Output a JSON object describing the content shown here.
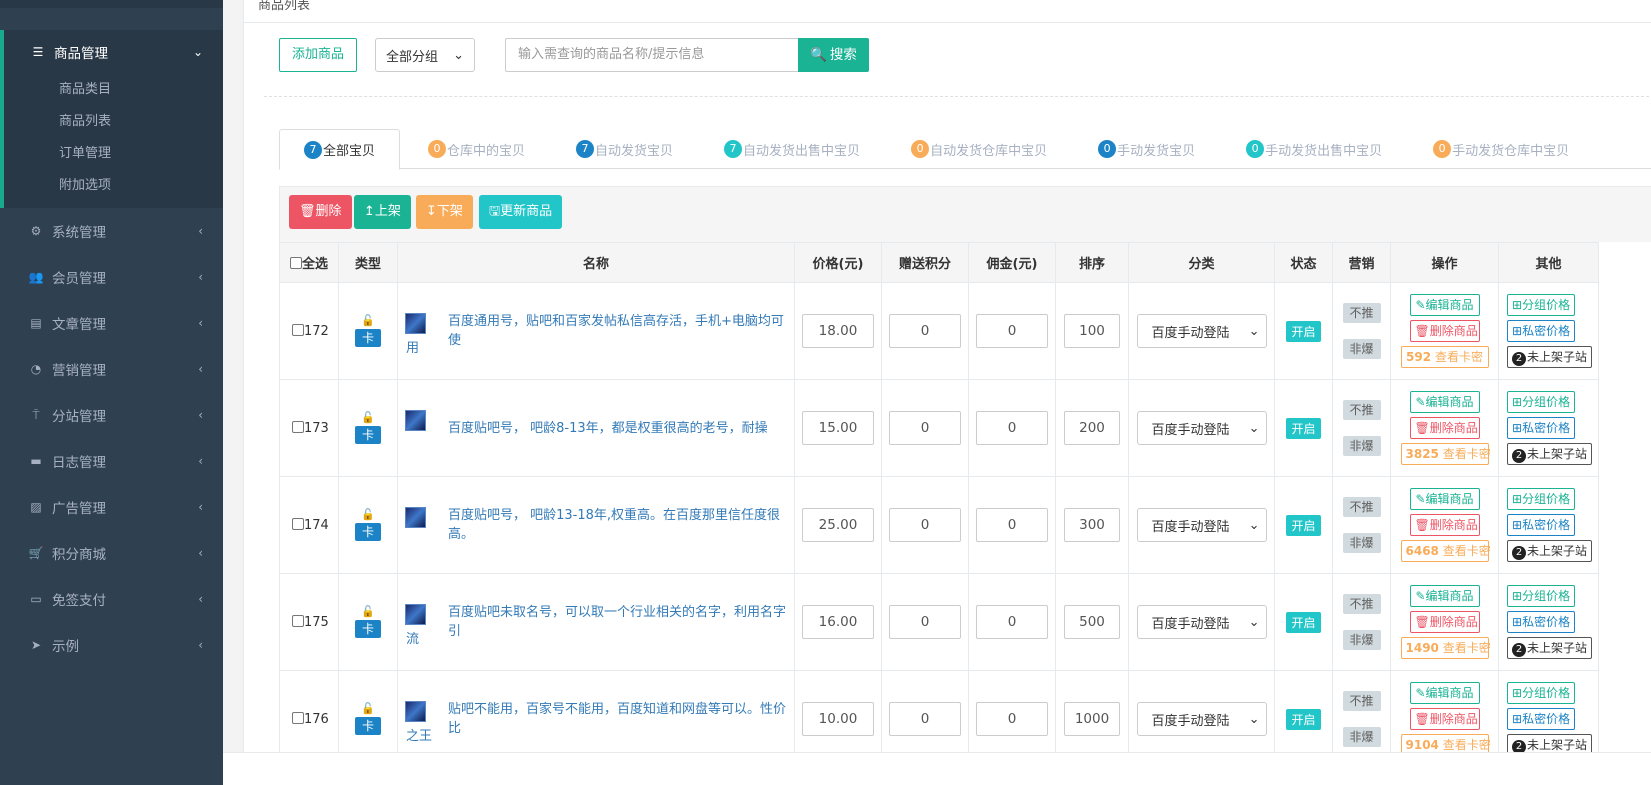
{
  "sidebar": {
    "active_menu": {
      "icon": "list-icon",
      "label": "商品管理",
      "chevron": "chevron-down"
    },
    "sub_items": [
      "商品类目",
      "商品列表",
      "订单管理",
      "附加选项"
    ],
    "menus": [
      {
        "icon": "gear-icon",
        "label": "系统管理"
      },
      {
        "icon": "users-icon",
        "label": "会员管理"
      },
      {
        "icon": "file-icon",
        "label": "文章管理"
      },
      {
        "icon": "pie-chart-icon",
        "label": "营销管理"
      },
      {
        "icon": "sitemap-icon",
        "label": "分站管理"
      },
      {
        "icon": "log-icon",
        "label": "日志管理"
      },
      {
        "icon": "image-icon",
        "label": "广告管理"
      },
      {
        "icon": "cart-icon",
        "label": "积分商城"
      },
      {
        "icon": "card-icon",
        "label": "免签支付"
      },
      {
        "icon": "send-icon",
        "label": "示例"
      }
    ]
  },
  "panel": {
    "title": "商品列表"
  },
  "toolbar": {
    "add_label": "添加商品",
    "category_select": "全部分组",
    "search_placeholder": "输入需查询的商品名称/提示信息",
    "search_label": "搜索"
  },
  "tabs": [
    {
      "count": "7",
      "label": "全部宝贝",
      "color": "#1c84c6",
      "active": true
    },
    {
      "count": "0",
      "label": "仓库中的宝贝",
      "color": "#f8ac59"
    },
    {
      "count": "7",
      "label": "自动发货宝贝",
      "color": "#1c84c6"
    },
    {
      "count": "7",
      "label": "自动发货出售中宝贝",
      "color": "#23c6c8"
    },
    {
      "count": "0",
      "label": "自动发货仓库中宝贝",
      "color": "#f8ac59"
    },
    {
      "count": "0",
      "label": "手动发货宝贝",
      "color": "#1c84c6"
    },
    {
      "count": "0",
      "label": "手动发货出售中宝贝",
      "color": "#23c6c8"
    },
    {
      "count": "0",
      "label": "手动发货仓库中宝贝",
      "color": "#f8ac59"
    }
  ],
  "actions": {
    "delete": "删除",
    "up": "上架",
    "down": "下架",
    "update": "更新商品"
  },
  "table": {
    "headers": {
      "select_all": "全选",
      "type": "类型",
      "name": "名称",
      "price": "价格(元)",
      "points": "赠送积分",
      "commission": "佣金(元)",
      "sort": "排序",
      "category": "分类",
      "status": "状态",
      "marketing": "营销",
      "ops": "操作",
      "other": "其他"
    },
    "rows": [
      {
        "id": "172",
        "type_tag": "卡",
        "name": "百度通用号，贴吧和百家发帖私信高存活，手机+电脑均可使",
        "name_tail": "用",
        "price": "18.00",
        "points": "0",
        "commission": "0",
        "sort": "100",
        "category": "百度手动登陆",
        "status": "开启",
        "mk1": "不推",
        "mk2": "非爆",
        "edit": "编辑商品",
        "del": "删除商品",
        "card_count": "592",
        "card_label": "查看卡密",
        "group_price": "分组价格",
        "private_price": "私密价格",
        "sub_count": "2",
        "sub_label": "未上架子站"
      },
      {
        "id": "173",
        "type_tag": "卡",
        "name": "百度贴吧号， 吧龄8-13年，都是权重很高的老号，耐操",
        "name_tail": "",
        "price": "15.00",
        "points": "0",
        "commission": "0",
        "sort": "200",
        "category": "百度手动登陆",
        "status": "开启",
        "mk1": "不推",
        "mk2": "非爆",
        "edit": "编辑商品",
        "del": "删除商品",
        "card_count": "3825",
        "card_label": "查看卡密",
        "group_price": "分组价格",
        "private_price": "私密价格",
        "sub_count": "2",
        "sub_label": "未上架子站"
      },
      {
        "id": "174",
        "type_tag": "卡",
        "name": "百度贴吧号， 吧龄13-18年,权重高。在百度那里信任度很高。",
        "name_tail": "",
        "price": "25.00",
        "points": "0",
        "commission": "0",
        "sort": "300",
        "category": "百度手动登陆",
        "status": "开启",
        "mk1": "不推",
        "mk2": "非爆",
        "edit": "编辑商品",
        "del": "删除商品",
        "card_count": "6468",
        "card_label": "查看卡密",
        "group_price": "分组价格",
        "private_price": "私密价格",
        "sub_count": "2",
        "sub_label": "未上架子站"
      },
      {
        "id": "175",
        "type_tag": "卡",
        "name": "百度贴吧未取名号，可以取一个行业相关的名字，利用名字引",
        "name_tail": "流",
        "price": "16.00",
        "points": "0",
        "commission": "0",
        "sort": "500",
        "category": "百度手动登陆",
        "status": "开启",
        "mk1": "不推",
        "mk2": "非爆",
        "edit": "编辑商品",
        "del": "删除商品",
        "card_count": "1490",
        "card_label": "查看卡密",
        "group_price": "分组价格",
        "private_price": "私密价格",
        "sub_count": "2",
        "sub_label": "未上架子站"
      },
      {
        "id": "176",
        "type_tag": "卡",
        "name": "贴吧不能用，百家号不能用，百度知道和网盘等可以。性价比",
        "name_tail": "之王",
        "price": "10.00",
        "points": "0",
        "commission": "0",
        "sort": "1000",
        "category": "百度手动登陆",
        "status": "开启",
        "mk1": "不推",
        "mk2": "非爆",
        "edit": "编辑商品",
        "del": "删除商品",
        "card_count": "9104",
        "card_label": "查看卡密",
        "group_price": "分组价格",
        "private_price": "私密价格",
        "sub_count": "2",
        "sub_label": "未上架子站"
      }
    ]
  },
  "colors": {
    "sidebar_bg": "#2f4050",
    "accent": "#1ab394",
    "danger": "#ed5565",
    "warning": "#f8ac59",
    "info": "#23c6c8",
    "primary": "#1c84c6"
  }
}
